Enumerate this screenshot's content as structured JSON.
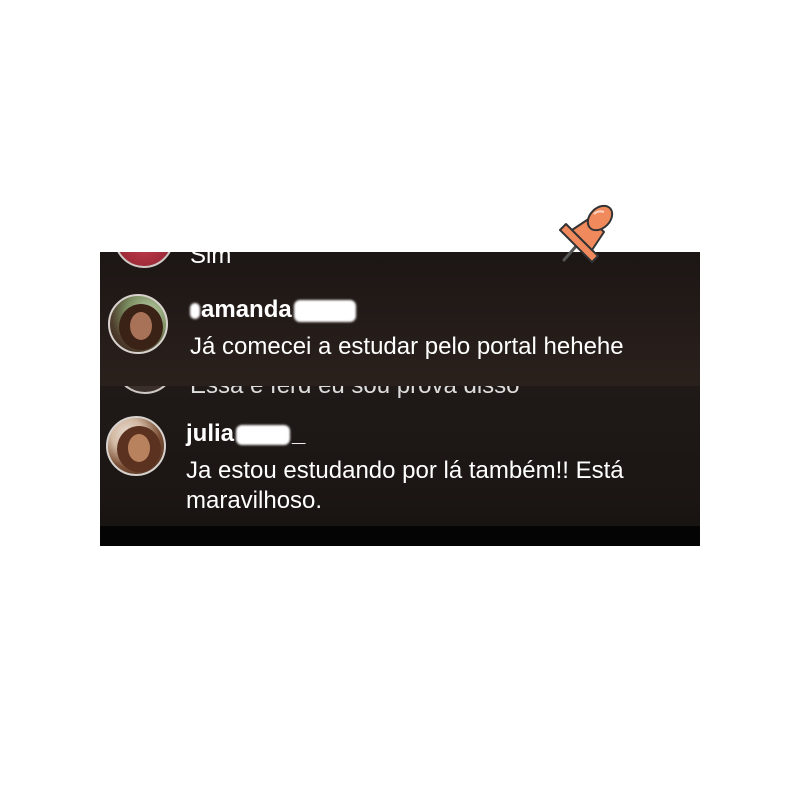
{
  "comments": {
    "previous_top": {
      "text": "Sim"
    },
    "amanda": {
      "username_prefix": "",
      "username": "amanda",
      "message": "Já comecei a estudar pelo portal hehehe"
    },
    "previous_bottom": {
      "text": "Essa é ferd eu sou prova disso"
    },
    "julia": {
      "username": "julia",
      "username_suffix": "_",
      "message_line1": "Ja estou estudando por lá também!! Está",
      "message_line2": "maravilhoso."
    }
  },
  "decorations": {
    "pin_icon": "pushpin-icon",
    "pin_color": "#f08a5d",
    "panel_background": "#1e1815"
  }
}
